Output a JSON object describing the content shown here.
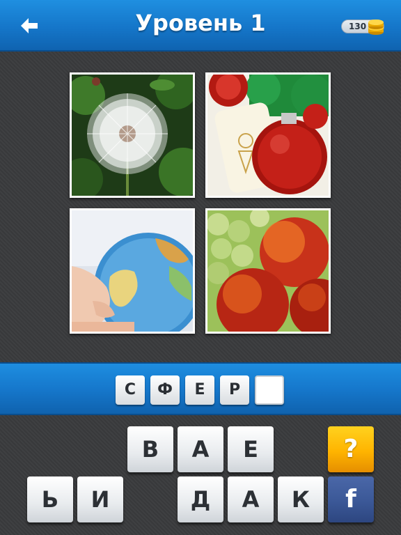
{
  "header": {
    "title": "Уровень 1",
    "coins": "130",
    "back_icon": "arrow-left-icon",
    "coin_icon": "gold-coins-icon"
  },
  "photos": [
    {
      "subject": "dandelion"
    },
    {
      "subject": "candle-and-christmas-ornament"
    },
    {
      "subject": "globe"
    },
    {
      "subject": "peaches-and-grapes"
    }
  ],
  "answer": {
    "slots": [
      "С",
      "Ф",
      "Е",
      "Р",
      ""
    ]
  },
  "keyboard": {
    "row1": [
      "В",
      "А",
      "Е"
    ],
    "row2_left": [
      "Ь",
      "И"
    ],
    "row2_right": [
      "Д",
      "А",
      "К"
    ]
  },
  "buttons": {
    "help_label": "?",
    "facebook_label": "f"
  },
  "colors": {
    "header_blue": "#1576c9",
    "help_yellow": "#ffb400",
    "facebook_blue": "#3b5897",
    "background": "#3a3b3d"
  }
}
